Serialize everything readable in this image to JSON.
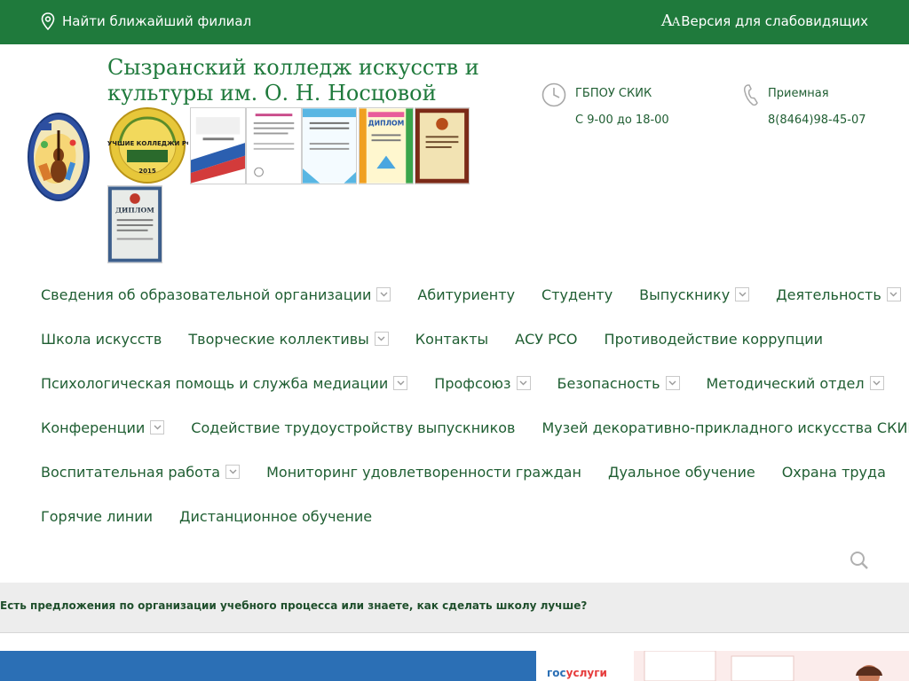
{
  "topbar": {
    "branch_label": "Найти ближайший филиал",
    "vision_aa": "Aa",
    "vision_label": "Версия для слабовидящих"
  },
  "header": {
    "title": "Сызранский колледж искусств и культуры им. О. Н. Носцовой",
    "award_top_label": "ЛУЧШИЕ КОЛЛЕДЖИ РФ",
    "award_year": "2015",
    "diploma_label": "ДИПЛОМ"
  },
  "contacts": [
    {
      "label": "ГБПОУ СКИК",
      "value": "С 9-00 до 18-00",
      "icon": "clock-icon"
    },
    {
      "label": "Приемная",
      "value": "8(8464)98-45-07",
      "icon": "phone-icon"
    }
  ],
  "nav": {
    "rows": [
      [
        {
          "label": "Сведения об образовательной организации",
          "dropdown": true
        },
        {
          "label": "Абитуриенту",
          "dropdown": false
        },
        {
          "label": "Студенту",
          "dropdown": false
        },
        {
          "label": "Выпускнику",
          "dropdown": true
        },
        {
          "label": "Деятельность",
          "dropdown": true
        }
      ],
      [
        {
          "label": "Школа искусств",
          "dropdown": false
        },
        {
          "label": "Творческие коллективы",
          "dropdown": true
        },
        {
          "label": "Контакты",
          "dropdown": false
        },
        {
          "label": "АСУ РСО",
          "dropdown": false
        },
        {
          "label": "Противодействие коррупции",
          "dropdown": false
        }
      ],
      [
        {
          "label": "Психологическая помощь и служба медиации",
          "dropdown": true
        },
        {
          "label": "Профсоюз",
          "dropdown": true
        },
        {
          "label": "Безопасность",
          "dropdown": true
        },
        {
          "label": "Методический отдел",
          "dropdown": true
        }
      ],
      [
        {
          "label": "Конференции",
          "dropdown": true
        },
        {
          "label": "Содействие трудоустройству выпускников",
          "dropdown": false
        },
        {
          "label": "Музей декоративно-прикладного искусства СКИК",
          "dropdown": false
        }
      ],
      [
        {
          "label": "Воспитательная работа",
          "dropdown": true
        },
        {
          "label": "Мониторинг удовлетворенности граждан",
          "dropdown": false
        },
        {
          "label": "Дуальное обучение",
          "dropdown": false
        },
        {
          "label": "Охрана труда",
          "dropdown": false
        }
      ],
      [
        {
          "label": "Горячие линии",
          "dropdown": false
        },
        {
          "label": "Дистанционное обучение",
          "dropdown": false
        }
      ]
    ]
  },
  "feedback": {
    "text": "Есть предложения по организации учебного процесса или знаете, как сделать школу лучше?"
  },
  "banner": {
    "gos_part1": "гос",
    "gos_part2": "услуги"
  },
  "colors": {
    "brand_green": "#1f7a3c",
    "text_green": "#1f5e32",
    "banner_blue": "#2b6fb5",
    "banner_red": "#e63b3b"
  }
}
